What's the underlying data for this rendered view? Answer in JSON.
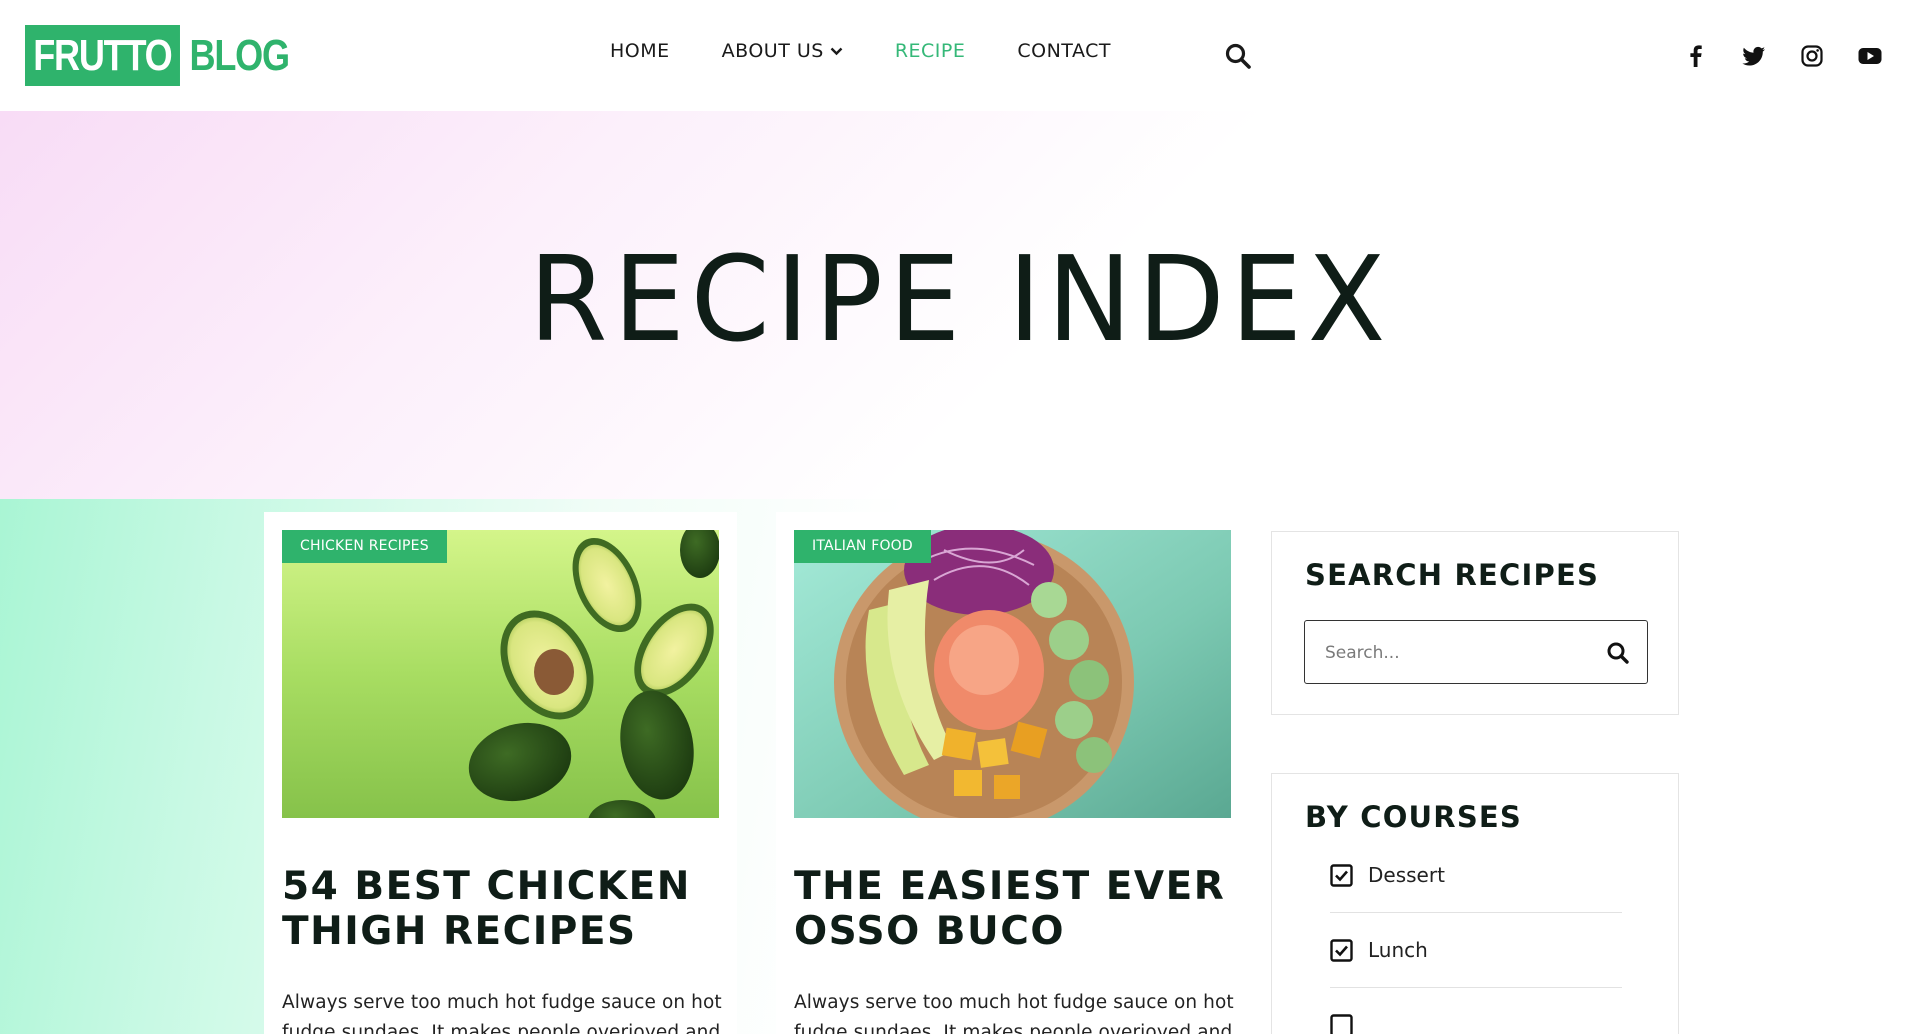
{
  "header": {
    "logo_box": "FRUTTO",
    "logo_rest": "BLOG",
    "nav": [
      {
        "label": "HOME"
      },
      {
        "label": "ABOUT US"
      },
      {
        "label": "RECIPE"
      },
      {
        "label": "CONTACT"
      }
    ],
    "social": [
      "facebook-icon",
      "twitter-icon",
      "instagram-icon",
      "youtube-icon"
    ]
  },
  "hero": {
    "title": "RECIPE INDEX"
  },
  "cards": [
    {
      "tag": "CHICKEN RECIPES",
      "title": "54 BEST CHICKEN THIGH RECIPES",
      "text": "Always serve too much hot fudge sauce on hot fudge sundaes. It makes people overjoyed and"
    },
    {
      "tag": "ITALIAN FOOD",
      "title": "THE EASIEST EVER OSSO BUCO",
      "text": "Always serve too much hot fudge sauce on hot fudge sundaes. It makes people overjoyed and"
    }
  ],
  "sidebar": {
    "search_title": "SEARCH RECIPES",
    "search_placeholder": "Search...",
    "courses_title": "BY COURSES",
    "courses": [
      "Dessert",
      "Lunch"
    ]
  },
  "colors": {
    "brand_green": "#2fb36c",
    "active_nav": "#35b878",
    "dark_text": "#0f1d17"
  }
}
